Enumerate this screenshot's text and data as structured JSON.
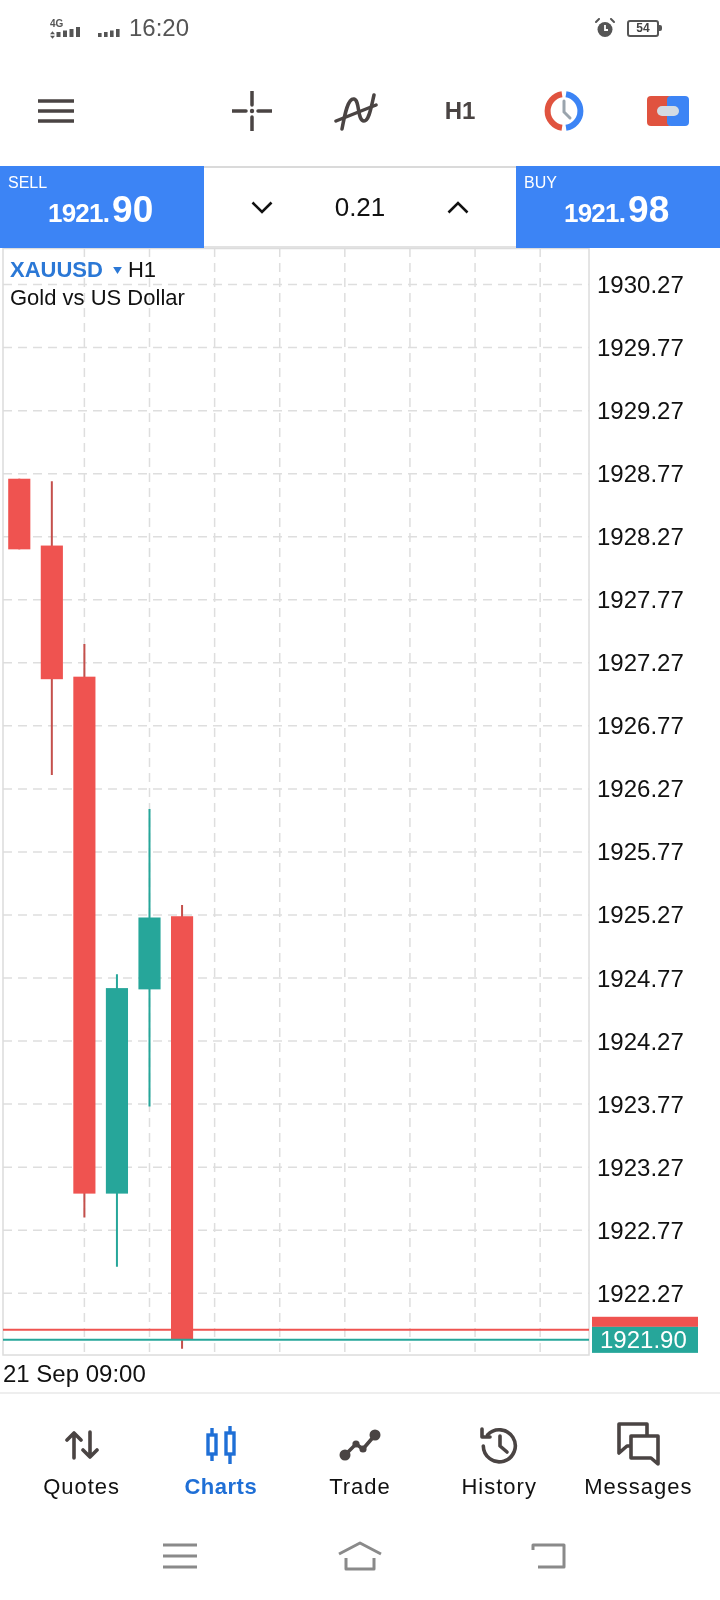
{
  "status_bar": {
    "network": "4G",
    "time": "16:20",
    "battery": "54"
  },
  "toolbar": {
    "timeframe": "H1"
  },
  "trade_panel": {
    "sell": {
      "label": "SELL",
      "price_head": "1921.",
      "price_tail": "90"
    },
    "volume": "0.21",
    "buy": {
      "label": "BUY",
      "price_head": "1921.",
      "price_tail": "98"
    }
  },
  "chart": {
    "symbol": "XAUUSD",
    "timeframe": "H1",
    "description": "Gold vs US Dollar",
    "chart_data": {
      "type": "candlestick",
      "categories": [
        null,
        null,
        null,
        null,
        null,
        null,
        null,
        null,
        null,
        null,
        null,
        null,
        null,
        null,
        null,
        null,
        null,
        null
      ],
      "ohlc": [
        [
          1928.73,
          1928.73,
          1928.17,
          1928.17
        ],
        [
          1928.2,
          1928.71,
          1926.38,
          1927.14
        ],
        [
          1927.16,
          1927.42,
          1922.87,
          1923.06
        ],
        [
          1923.06,
          1924.8,
          1922.48,
          1924.69
        ],
        [
          1924.68,
          1926.11,
          1923.75,
          1925.25
        ],
        [
          1925.26,
          1925.35,
          1921.83,
          1921.9
        ],
        null,
        null,
        null,
        null,
        null,
        null,
        null,
        null,
        null,
        null,
        null,
        null
      ],
      "ylim": [
        1921.78,
        1930.56
      ],
      "yticks": [
        1930.27,
        1929.77,
        1929.27,
        1928.77,
        1928.27,
        1927.77,
        1927.27,
        1926.77,
        1926.27,
        1925.77,
        1925.27,
        1924.77,
        1924.27,
        1923.77,
        1923.27,
        1922.77,
        1922.27
      ],
      "grid": true,
      "ref_lines": [
        {
          "axis": "y",
          "value": 1921.98,
          "color": "#ef5350"
        },
        {
          "axis": "y",
          "value": 1921.9,
          "label": "1921.90",
          "color": "#26a69a"
        }
      ],
      "annotations": [
        "21 Sep 09:00"
      ]
    }
  },
  "bottom_nav": [
    {
      "label": "Quotes",
      "selected": false
    },
    {
      "label": "Charts",
      "selected": true
    },
    {
      "label": "Trade",
      "selected": false
    },
    {
      "label": "History",
      "selected": false
    },
    {
      "label": "Messages",
      "selected": false
    }
  ]
}
